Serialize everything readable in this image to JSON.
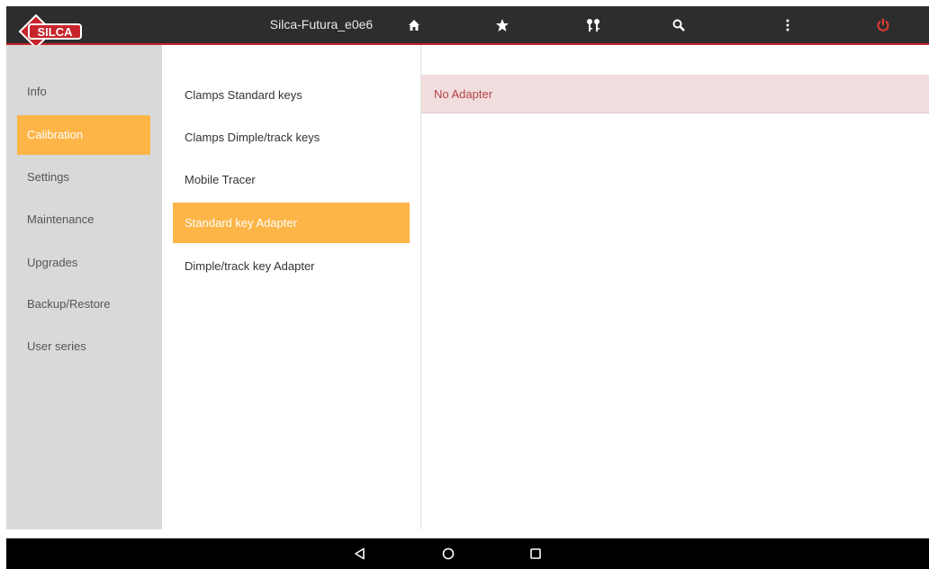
{
  "header": {
    "brand": "SILCA",
    "device_name": "Silca-Futura_e0e6",
    "icons": [
      "home-icon",
      "star-icon",
      "keys-icon",
      "search-icon",
      "more-vert-icon",
      "power-icon"
    ]
  },
  "sidebar": {
    "items": [
      {
        "label": "Info"
      },
      {
        "label": "Calibration",
        "active": true
      },
      {
        "label": "Settings"
      },
      {
        "label": "Maintenance"
      },
      {
        "label": "Upgrades"
      },
      {
        "label": "Backup/Restore"
      },
      {
        "label": "User series"
      }
    ]
  },
  "calibration_list": {
    "items": [
      {
        "label": "Clamps Standard keys"
      },
      {
        "label": "Clamps Dimple/track keys"
      },
      {
        "label": "Mobile Tracer"
      },
      {
        "label": "Standard key Adapter",
        "active": true
      },
      {
        "label": "Dimple/track key Adapter"
      }
    ]
  },
  "detail": {
    "status": "No Adapter"
  },
  "android_nav": {
    "icons": [
      "back-icon",
      "home-circle-icon",
      "recents-icon"
    ]
  },
  "colors": {
    "accent": "#fdb548",
    "topbar": "#2d2d2d",
    "topbar_border": "#c7242b",
    "power": "#e53935",
    "banner_bg": "#f1dddd",
    "banner_text": "#b3444a"
  }
}
